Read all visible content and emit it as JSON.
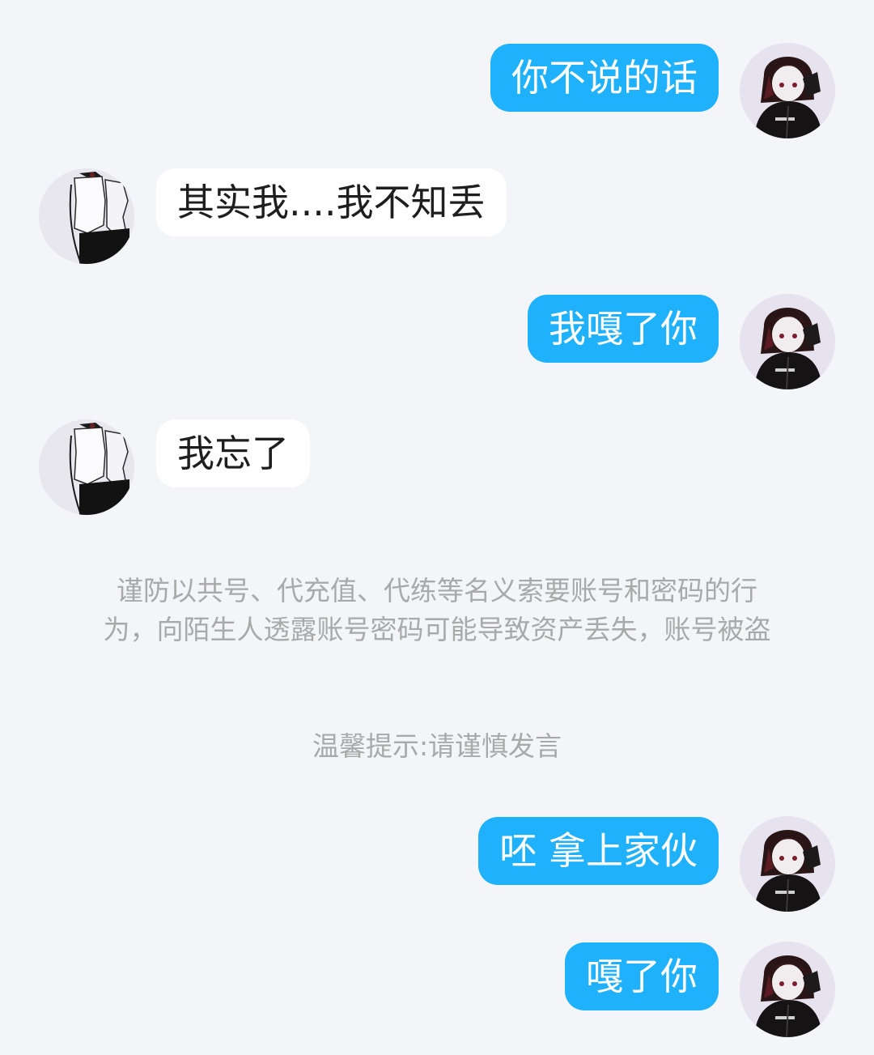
{
  "colors": {
    "background": "#f3f5f9",
    "outgoing_bubble": "#1fb1fb",
    "incoming_bubble": "#ffffff",
    "notice_text": "#a9a9a9"
  },
  "messages": [
    {
      "side": "out",
      "text": "你不说的话",
      "avatar_icon": "my-avatar-icon"
    },
    {
      "side": "in",
      "text": "其实我....我不知丢",
      "avatar_icon": "peer-avatar-icon"
    },
    {
      "side": "out",
      "text": "我嘎了你",
      "avatar_icon": "my-avatar-icon"
    },
    {
      "side": "in",
      "text": "我忘了",
      "avatar_icon": "peer-avatar-icon"
    },
    {
      "side": "out",
      "text": "呸 拿上家伙",
      "avatar_icon": "my-avatar-icon"
    },
    {
      "side": "out",
      "text": "嘎了你",
      "avatar_icon": "my-avatar-icon"
    }
  ],
  "security_notice": {
    "line1": "谨防以共号、代充值、代练等名义索要账号和密码的行",
    "line2": "为，向陌生人透露账号密码可能导致资产丢失，账号被盗"
  },
  "reminder": "温馨提示:请谨慎发言"
}
